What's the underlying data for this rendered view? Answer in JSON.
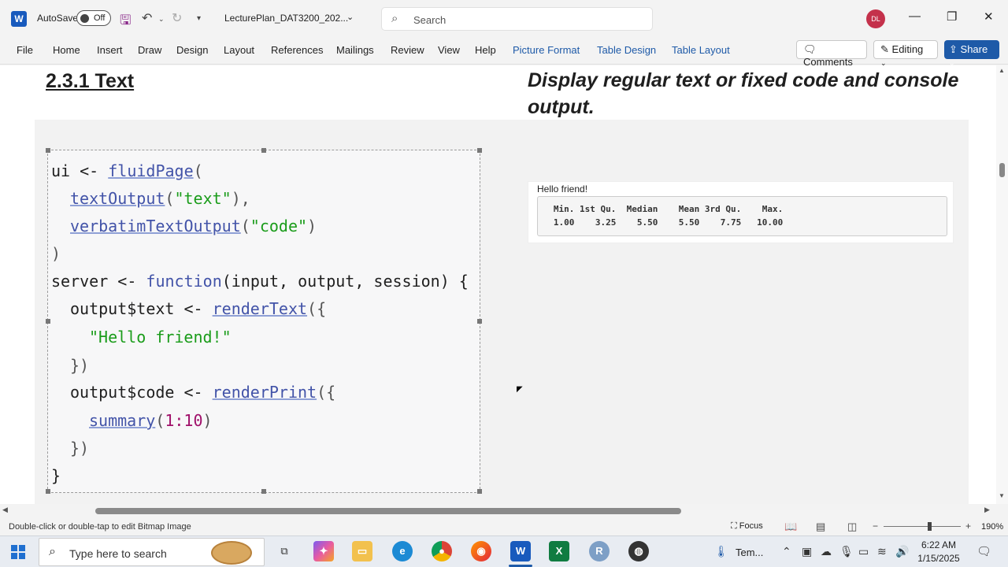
{
  "titlebar": {
    "autosave_label": "AutoSave",
    "autosave_state": "Off",
    "doc_title": "LecturePlan_DAT3200_202...",
    "search_placeholder": "Search",
    "avatar_initials": "DL"
  },
  "ribbon": {
    "tabs": [
      "File",
      "Home",
      "Insert",
      "Draw",
      "Design",
      "Layout",
      "References",
      "Mailings",
      "Review",
      "View",
      "Help",
      "Picture Format",
      "Table Design",
      "Table Layout"
    ],
    "comments_label": "Comments",
    "editing_label": "Editing",
    "share_label": "Share"
  },
  "document": {
    "heading": "2.3.1 Text",
    "description": "Display regular text or fixed code and console output.",
    "code": {
      "l1a": "ui <- ",
      "l1fn": "fluidPage",
      "l1b": "(",
      "l2fn": "textOutput",
      "l2b": "(",
      "l2s": "\"text\"",
      "l2c": "),",
      "l3fn": "verbatimTextOutput",
      "l3b": "(",
      "l3s": "\"code\"",
      "l3c": ")",
      "l4": ")",
      "l5a": "server <- ",
      "l5kw": "function",
      "l5b": "(input, output, session) {",
      "l6a": "output$text <- ",
      "l6fn": "renderText",
      "l6b": "({",
      "l7s": "\"Hello friend!\"",
      "l8": "})",
      "l9a": "output$code <- ",
      "l9fn": "renderPrint",
      "l9b": "({",
      "l10fn": "summary",
      "l10b": "(",
      "l10n": "1:10",
      "l10c": ")",
      "l11": "})",
      "l12": "}"
    },
    "output": {
      "text": "Hello friend!",
      "summary_header": "   Min. 1st Qu.  Median    Mean 3rd Qu.    Max. ",
      "summary_values": "   1.00    3.25    5.50    5.50    7.75   10.00 "
    }
  },
  "statusbar": {
    "hint": "Double-click or double-tap to edit Bitmap Image",
    "focus_label": "Focus",
    "zoom": "190%"
  },
  "taskbar": {
    "search_placeholder": "Type here to search",
    "weather": "Tem...",
    "time": "6:22 AM",
    "date": "1/15/2025"
  }
}
